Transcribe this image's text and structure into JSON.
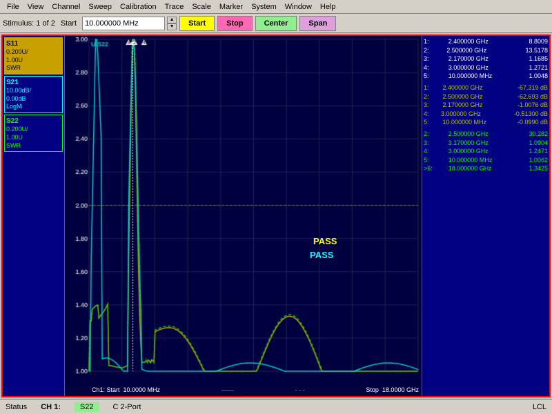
{
  "menubar": {
    "items": [
      "File",
      "View",
      "Channel",
      "Sweep",
      "Calibration",
      "Trace",
      "Scale",
      "Marker",
      "System",
      "Window",
      "Help"
    ]
  },
  "toolbar": {
    "stimulus_label": "Stimulus: 1 of 2",
    "start_label": "Start",
    "start_value": "10.000000 MHz",
    "btn_start": "Start",
    "btn_stop": "Stop",
    "btn_center": "Center",
    "btn_span": "Span"
  },
  "traces": [
    {
      "id": "S11",
      "line1": "S11",
      "line2": "0.200U/",
      "line3": "1.00U",
      "line4": "SWR",
      "style": "s11"
    },
    {
      "id": "S21",
      "line1": "S21",
      "line2": "10.00dB/",
      "line3": "0.00dB",
      "line4": "LogM",
      "style": "s21"
    },
    {
      "id": "S22",
      "line1": "S22",
      "line2": "0.200U/",
      "line3": "1.00U",
      "line4": "SWR",
      "style": "s22"
    }
  ],
  "y_axis": {
    "labels": [
      "3.00",
      "2.80",
      "2.60",
      "2.40",
      "2.20",
      "2.00",
      "1.80",
      "1.60",
      "1.40",
      "1.20",
      "1.00"
    ]
  },
  "markers": {
    "section1": {
      "label": "",
      "rows": [
        {
          "num": "1:",
          "freq": "2.400000 GHz",
          "val": "8.8009"
        },
        {
          "num": "2:",
          "freq": "2.500000 GHz",
          "val": "13.5178"
        },
        {
          "num": "3:",
          "freq": "2.170000 GHz",
          "val": "1.1685"
        },
        {
          "num": "4:",
          "freq": "3.000000 GHz",
          "val": "1.2721"
        },
        {
          "num": "5:",
          "freq": "10.000000 MHz",
          "val": "1.0048"
        }
      ]
    },
    "section2": {
      "label": "",
      "rows": [
        {
          "num": "1:",
          "freq": "2.400000 GHz",
          "val": "-67.319 dB"
        },
        {
          "num": "2:",
          "freq": "2.500000 GHz",
          "val": "-62.693 dB"
        },
        {
          "num": "3:",
          "freq": "2.170000 GHz",
          "val": "-1.0076 dB"
        },
        {
          "num": "4:",
          "freq": "3.000000 GHz",
          "val": "-0.51300 dB"
        },
        {
          "num": "5:",
          "freq": "10.000000 MHz",
          "val": "-0.0990 dB"
        }
      ]
    },
    "section3": {
      "label": "",
      "rows": [
        {
          "num": "2:",
          "freq": "2.500000 GHz",
          "val": "30.282"
        },
        {
          "num": "3:",
          "freq": "3.170000 GHz",
          "val": "1.0904"
        },
        {
          "num": "4:",
          "freq": "3.000000 GHz",
          "val": "1.2471"
        },
        {
          "num": "5:",
          "freq": "10.000000 MHz",
          "val": "1.0062"
        },
        {
          "num": ">6:",
          "freq": "18.000000 GHz",
          "val": "1.3425"
        }
      ]
    }
  },
  "pass_labels": [
    "PASS",
    "PASS"
  ],
  "bottom_axis": {
    "ch_label": "Ch1: Start",
    "start_freq": "10.0000 MHz",
    "stop_label": "Stop",
    "stop_freq": "18.0000 GHz"
  },
  "statusbar": {
    "status_label": "Status",
    "ch_label": "CH 1:",
    "ch_value": "S22",
    "mode": "C 2-Port",
    "lcl": "LCL"
  },
  "chart": {
    "grid_color": "#304060",
    "background": "#000040",
    "ref_line_color": "#808000",
    "ref_line_value": 2.0
  }
}
